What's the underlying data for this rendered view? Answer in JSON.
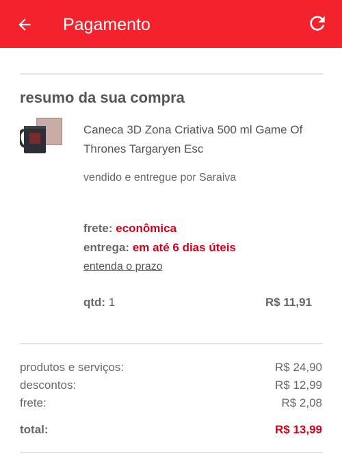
{
  "app_bar": {
    "title": "Pagamento",
    "back_icon": "arrow-left-icon",
    "refresh_icon": "refresh-icon",
    "color": "#f4222d"
  },
  "summary": {
    "title": "resumo da sua compra",
    "product": {
      "image_icon": "mug-product-image",
      "name": "Caneca 3D Zona Criativa 500 ml Game Of Thrones Targaryen Esc",
      "seller": "vendido e entregue por Saraiva"
    },
    "shipping": {
      "label": "frete:",
      "value": "econômica"
    },
    "delivery": {
      "label": "entrega:",
      "value": "em até 6 dias úteis"
    },
    "deadline_link": "entenda o prazo",
    "quantity": {
      "label": "qtd:",
      "value": "1"
    },
    "item_price": "R$ 11,91"
  },
  "totals": {
    "products_label": "produtos e serviços:",
    "products_value": "R$ 24,90",
    "discounts_label": "descontos:",
    "discounts_value": "R$ 12,99",
    "freight_label": "frete:",
    "freight_value": "R$ 2,08",
    "total_label": "total:",
    "total_value": "R$ 13,99"
  },
  "colors": {
    "accent": "#d0021b",
    "text": "#555555"
  }
}
